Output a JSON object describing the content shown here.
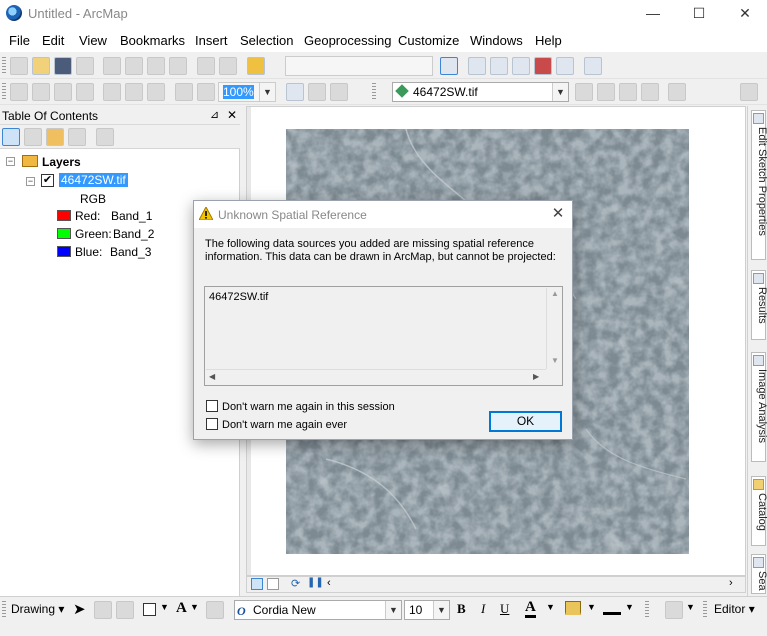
{
  "window": {
    "title": "Untitled - ArcMap",
    "minimize": "—",
    "maximize": "☐",
    "close": "✕"
  },
  "menu": [
    "File",
    "Edit",
    "View",
    "Bookmarks",
    "Insert",
    "Selection",
    "Geoprocessing",
    "Customize",
    "Windows",
    "Help"
  ],
  "toolbar": {
    "scale_value": "",
    "zoom_value": "100%",
    "layer_select": "46472SW.tif"
  },
  "toc": {
    "title": "Table Of Contents",
    "pin": "⊿",
    "close": "✕",
    "root_label": "Layers",
    "layer_name": "46472SW.tif",
    "rgb_label": "RGB",
    "bands": [
      {
        "channel": "Red:",
        "band": "Band_1",
        "color": "#ff0000"
      },
      {
        "channel": "Green:",
        "band": "Band_2",
        "color": "#00ff00"
      },
      {
        "channel": "Blue:",
        "band": "Band_3",
        "color": "#0000ff"
      }
    ]
  },
  "dock_tabs": [
    "Edit Sketch Properties",
    "Results",
    "Image Analysis",
    "Catalog",
    "Sea"
  ],
  "drawing_toolbar": {
    "drawing_label": "Drawing",
    "font_name": "Cordia New",
    "font_size": "10",
    "bold": "B",
    "italic": "I",
    "underline": "U",
    "font_color_label": "A",
    "editor_label": "Editor"
  },
  "dialog": {
    "title": "Unknown Spatial Reference",
    "message": "The following data sources you added are missing spatial reference information. This data can be drawn in ArcMap, but cannot be projected:",
    "items": [
      "46472SW.tif"
    ],
    "checkbox_session": "Don't warn me again in this session",
    "checkbox_ever": "Don't warn me again ever",
    "ok": "OK",
    "close": "✕"
  },
  "colors": {
    "accent": "#0078d7",
    "selection": "#3399ff"
  }
}
